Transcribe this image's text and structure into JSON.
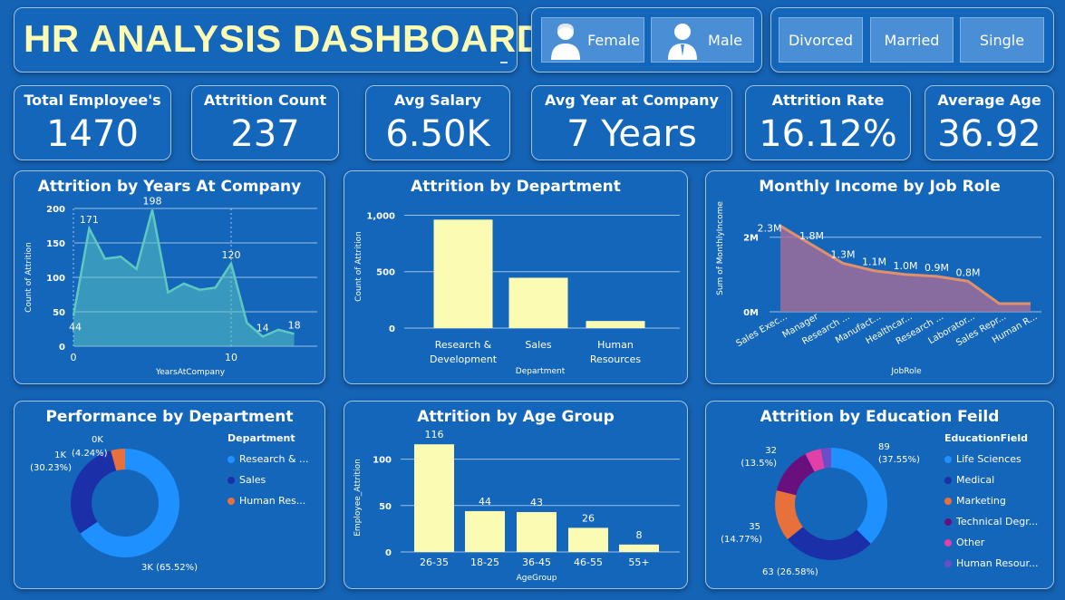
{
  "header": {
    "title": "HR ANALYSIS DASHBOARD"
  },
  "filters": {
    "gender": [
      {
        "label": "Female",
        "icon": "female-avatar-icon"
      },
      {
        "label": "Male",
        "icon": "male-avatar-icon"
      }
    ],
    "marital": [
      "Divorced",
      "Married",
      "Single"
    ]
  },
  "kpis": [
    {
      "label": "Total Employee's",
      "value": "1470"
    },
    {
      "label": "Attrition Count",
      "value": "237"
    },
    {
      "label": "Avg Salary",
      "value": "6.50K"
    },
    {
      "label": "Avg Year at Company",
      "value": "7 Years"
    },
    {
      "label": "Attrition Rate",
      "value": "16.12%"
    },
    {
      "label": "Average Age",
      "value": "36.92"
    }
  ],
  "colors": {
    "background": "#1463b5",
    "title": "#fbfbb4",
    "bar": "#fbfbb4",
    "area": "#5ec9c0",
    "income_line": "#e0906a"
  },
  "chart_data": [
    {
      "id": "years",
      "type": "area",
      "title": "Attrition by Years At Company",
      "xlabel": "YearsAtCompany",
      "ylabel": "Count of Attrition",
      "xlim": [
        0,
        15
      ],
      "ylim": [
        0,
        200
      ],
      "xticks": [
        0,
        10
      ],
      "yticks": [
        0,
        50,
        100,
        150,
        200
      ],
      "x": [
        0,
        1,
        2,
        3,
        4,
        5,
        6,
        7,
        8,
        9,
        10,
        11,
        12,
        13,
        14
      ],
      "values": [
        44,
        171,
        127,
        130,
        112,
        198,
        78,
        91,
        82,
        85,
        120,
        34,
        14,
        24,
        18
      ],
      "data_labels": [
        {
          "x": 0,
          "text": "44"
        },
        {
          "x": 1,
          "text": "171"
        },
        {
          "x": 5,
          "text": "198"
        },
        {
          "x": 10,
          "text": "120"
        },
        {
          "x": 12,
          "text": "14"
        },
        {
          "x": 14,
          "text": "18"
        }
      ]
    },
    {
      "id": "dept",
      "type": "bar",
      "title": "Attrition by Department",
      "xlabel": "Department",
      "ylabel": "Count of Attrition",
      "ylim": [
        0,
        1100
      ],
      "yticks": [
        0,
        500,
        1000
      ],
      "ytick_labels": [
        "0",
        "500",
        "1,000"
      ],
      "categories": [
        [
          "Research &",
          "Development"
        ],
        [
          "Sales"
        ],
        [
          "Human",
          "Resources"
        ]
      ],
      "values": [
        961,
        446,
        63
      ]
    },
    {
      "id": "income",
      "type": "area",
      "title": "Monthly Income by Job Role",
      "xlabel": "JobRole",
      "ylabel": "Sum of MonthlyIncome",
      "ylim": [
        0,
        2600000
      ],
      "yticks": [
        0,
        2000000
      ],
      "ytick_labels": [
        "0M",
        "2M"
      ],
      "categories": [
        "Sales Exec...",
        "Manager",
        "Research ...",
        "Manufact...",
        "Healthcar...",
        "Research ...",
        "Laborator...",
        "Sales Repr...",
        "Human R..."
      ],
      "values": [
        2300000,
        1800000,
        1300000,
        1100000,
        1000000,
        950000,
        820000,
        220000,
        220000
      ],
      "data_labels": [
        "2.3M",
        "1.8M",
        "1.3M",
        "1.1M",
        "1.0M",
        "0.9M",
        "0.8M",
        "",
        ""
      ]
    },
    {
      "id": "performance",
      "type": "pie",
      "title": "Performance by Department",
      "legend_title": "Department",
      "series": [
        {
          "name": "Research & ...",
          "value": 65.52,
          "color": "#1e90ff",
          "label": "3K (65.52%)"
        },
        {
          "name": "Sales",
          "value": 30.23,
          "color": "#1b2fa8",
          "label": "1K (30.23%)"
        },
        {
          "name": "Human Res...",
          "value": 4.24,
          "color": "#e8703a",
          "label": "0K (4.24%)"
        }
      ]
    },
    {
      "id": "age",
      "type": "bar",
      "title": "Attrition by Age Group",
      "xlabel": "AgeGroup",
      "ylabel": "Employee_Attrition",
      "ylim": [
        0,
        125
      ],
      "yticks": [
        0,
        50,
        100
      ],
      "categories": [
        "26-35",
        "18-25",
        "36-45",
        "46-55",
        "55+"
      ],
      "values": [
        116,
        44,
        43,
        26,
        8
      ]
    },
    {
      "id": "education",
      "type": "pie",
      "title": "Attrition by Education Feild",
      "legend_title": "EducationField",
      "series": [
        {
          "name": "Life Sciences",
          "value": 37.55,
          "color": "#1e90ff",
          "label": "89 (37.55%)"
        },
        {
          "name": "Medical",
          "value": 26.58,
          "color": "#1b2fa8",
          "label": "63 (26.58%)"
        },
        {
          "name": "Marketing",
          "value": 14.77,
          "color": "#e8703a",
          "label": "35 (14.77%)"
        },
        {
          "name": "Technical Degr...",
          "value": 13.5,
          "color": "#6a0f7e",
          "label": "32 (13.5%)"
        },
        {
          "name": "Other",
          "value": 4.64,
          "color": "#e040a8",
          "label": ""
        },
        {
          "name": "Human Resour...",
          "value": 2.96,
          "color": "#6a4ec8",
          "label": ""
        }
      ]
    }
  ]
}
